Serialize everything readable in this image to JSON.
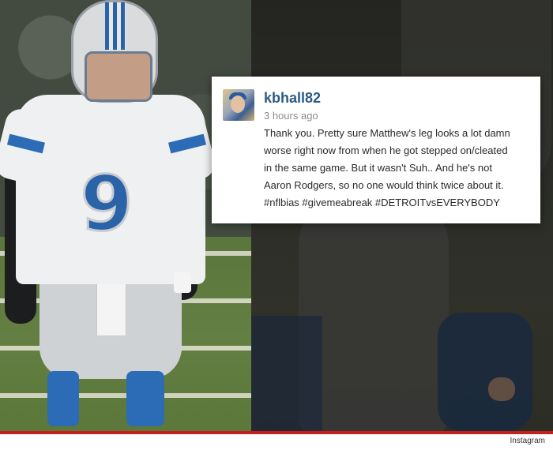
{
  "post": {
    "username": "kbhall82",
    "timestamp": "3 hours ago",
    "comment_lines": [
      "Thank you. Pretty sure Matthew's leg looks a lot damn",
      "worse right now from when he got stepped on/cleated",
      "in the same game. But it wasn't Suh.. And he's not",
      "Aaron Rodgers, so no one would think twice about it.",
      "#nflbias #givemeabreak #DETROITvsEVERYBODY"
    ]
  },
  "photo": {
    "jersey_number": "9"
  },
  "footer": {
    "credit": "Instagram"
  },
  "colors": {
    "username": "#2b5a83",
    "accent_rule": "#c81e1e",
    "jersey_blue": "#2b63a8"
  }
}
